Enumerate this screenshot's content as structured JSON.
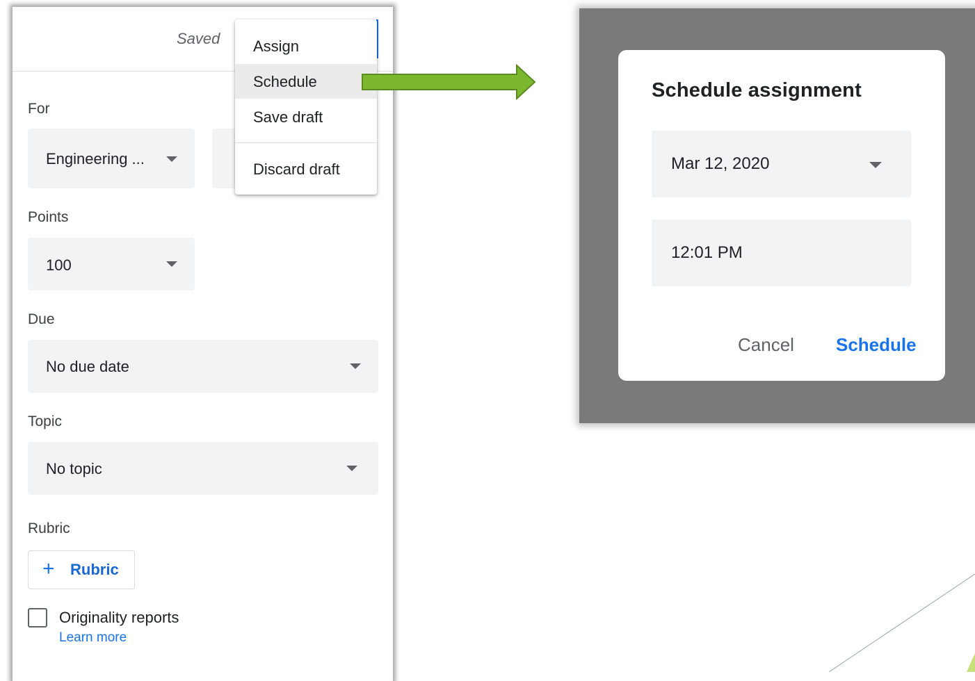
{
  "left": {
    "status": "Saved",
    "for_label": "For",
    "for_value": "Engineering ...",
    "points_label": "Points",
    "points_value": "100",
    "due_label": "Due",
    "due_value": "No due date",
    "topic_label": "Topic",
    "topic_value": "No topic",
    "rubric_label": "Rubric",
    "rubric_button": "Rubric",
    "originality_label": "Originality reports",
    "learn_more": "Learn more"
  },
  "menu": {
    "items": [
      "Assign",
      "Schedule",
      "Save draft",
      "Discard draft"
    ],
    "highlighted": "Schedule"
  },
  "dialog": {
    "title": "Schedule assignment",
    "date": "Mar 12, 2020",
    "time": "12:01 PM",
    "cancel": "Cancel",
    "confirm": "Schedule"
  },
  "colors": {
    "accent": "#1a73e8",
    "arrow": "#7cb82f",
    "overlay": "#7a7a7a",
    "field_bg": "#f1f3f4"
  }
}
